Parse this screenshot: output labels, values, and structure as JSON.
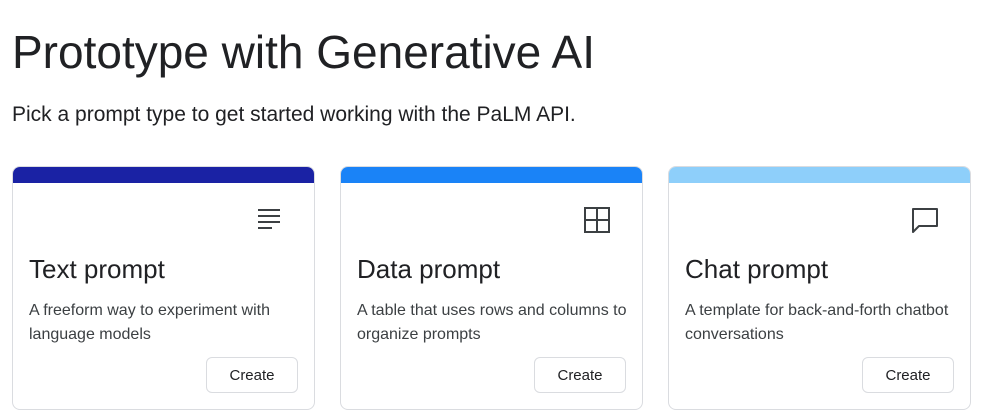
{
  "header": {
    "title": "Prototype with Generative AI",
    "subtitle": "Pick a prompt type to get started working with the PaLM API."
  },
  "cards": [
    {
      "title": "Text prompt",
      "description": "A freeform way to experiment with language models",
      "button_label": "Create",
      "accent_color": "#1a22a4",
      "icon": "text-lines-icon"
    },
    {
      "title": "Data prompt",
      "description": "A table that uses rows and columns to organize prompts",
      "button_label": "Create",
      "accent_color": "#1a83f7",
      "icon": "grid-table-icon"
    },
    {
      "title": "Chat prompt",
      "description": "A template for back-and-forth chatbot conversations",
      "button_label": "Create",
      "accent_color": "#8ecffa",
      "icon": "chat-bubble-icon"
    }
  ]
}
